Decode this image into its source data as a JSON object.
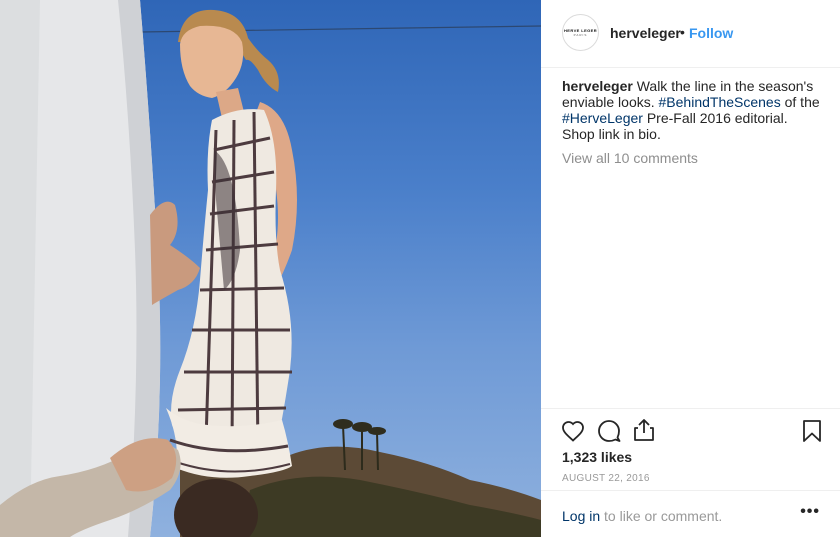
{
  "post": {
    "image_alt": "Model in a striped knit dress on set",
    "header": {
      "username": "herveleger",
      "separator": "•",
      "follow_label": "Follow",
      "avatar_logo_line1": "HERVE LEGER",
      "avatar_logo_line2": "PARIS"
    },
    "caption": {
      "username": "herveleger",
      "text_1": " Walk the line in the season's enviable looks. ",
      "hashtag_1": "#BehindTheScenes",
      "text_2": " of the ",
      "hashtag_2": "#HerveLeger",
      "text_3": " Pre-Fall 2016 editorial. Shop link in bio."
    },
    "view_comments": "View all 10 comments",
    "actions": {
      "like_icon": "heart-icon",
      "comment_icon": "comment-icon",
      "share_icon": "share-icon",
      "save_icon": "bookmark-icon"
    },
    "likes": "1,323 likes",
    "date": "AUGUST 22, 2016",
    "login": {
      "link": "Log in",
      "text": " to like or comment."
    },
    "more_label": "•••"
  },
  "colors": {
    "link_blue": "#3897f0",
    "hashtag": "#003569",
    "muted": "#8e8e8e",
    "sky": "#4a7fca"
  }
}
